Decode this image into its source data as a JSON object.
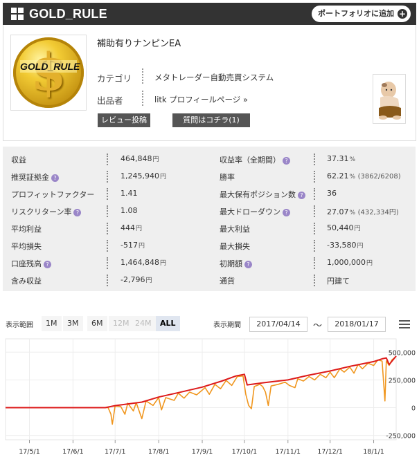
{
  "header": {
    "title": "GOLD_RULE",
    "portfolio_button": "ポートフォリオに追加",
    "plus_glyph": "+"
  },
  "product": {
    "logo_text": "GOLD_RULE",
    "logo_glyph": "$",
    "name": "補助有りナンピンEA",
    "category_label": "カテゴリ",
    "category_value": "メタトレーダー自動売買システム",
    "seller_label": "出品者",
    "seller_value": "litk プロフィールページ »",
    "review_button": "レビュー投稿",
    "question_button": "質問はコチラ(1)"
  },
  "stats": [
    {
      "l": "収益",
      "lq": false,
      "v": "464,848",
      "vu": "円",
      "l2": "収益率（全期間）",
      "l2q": true,
      "v2": "37.31",
      "v2u": "%",
      "v2s": ""
    },
    {
      "l": "推奨証拠金",
      "lq": true,
      "v": "1,245,940",
      "vu": "円",
      "l2": "勝率",
      "l2q": false,
      "v2": "62.21",
      "v2u": "%",
      "v2s": "(3862/6208)"
    },
    {
      "l": "プロフィットファクター",
      "lq": false,
      "v": "1.41",
      "vu": "",
      "l2": "最大保有ポジション数",
      "l2q": true,
      "v2": "36",
      "v2u": "",
      "v2s": ""
    },
    {
      "l": "リスクリターン率",
      "lq": true,
      "v": "1.08",
      "vu": "",
      "l2": "最大ドローダウン",
      "l2q": true,
      "v2": "27.07",
      "v2u": "%",
      "v2s": "(432,334円)"
    },
    {
      "l": "平均利益",
      "lq": false,
      "v": "444",
      "vu": "円",
      "l2": "最大利益",
      "l2q": false,
      "v2": "50,440",
      "v2u": "円",
      "v2s": ""
    },
    {
      "l": "平均損失",
      "lq": false,
      "v": "-517",
      "vu": "円",
      "l2": "最大損失",
      "l2q": false,
      "v2": "-33,580",
      "v2u": "円",
      "v2s": ""
    },
    {
      "l": "口座残高",
      "lq": true,
      "v": "1,464,848",
      "vu": "円",
      "l2": "初期額",
      "l2q": true,
      "v2": "1,000,000",
      "v2u": "円",
      "v2s": ""
    },
    {
      "l": "含み収益",
      "lq": false,
      "v": "-2,796",
      "vu": "円",
      "l2": "通貨",
      "l2q": false,
      "v2": "円建て",
      "v2u": "",
      "v2s": ""
    }
  ],
  "question_glyph": "?",
  "chart_controls": {
    "range_label": "表示範囲",
    "range_buttons": [
      {
        "label": "1M",
        "state": "normal"
      },
      {
        "label": "3M",
        "state": "normal"
      },
      {
        "label": "6M",
        "state": "normal"
      },
      {
        "label": "12M",
        "state": "disabled"
      },
      {
        "label": "24M",
        "state": "disabled"
      },
      {
        "label": "ALL",
        "state": "selected"
      }
    ],
    "period_label": "表示期間",
    "date_from": "2017/04/14",
    "tilde": "～",
    "date_to": "2018/01/17"
  },
  "chart_data": {
    "type": "line",
    "x_ticks": [
      "17/5/1",
      "17/6/1",
      "17/7/1",
      "17/8/1",
      "17/9/1",
      "17/10/1",
      "17/11/1",
      "17/12/1",
      "18/1/1"
    ],
    "y_ticks": [
      "500,000",
      "250,000",
      "0",
      "-250,000"
    ],
    "ylim": [
      -290000,
      620000
    ],
    "xlim": [
      "2017-04-14",
      "2018-01-17"
    ],
    "grid": true,
    "series": [
      {
        "color": "#dd1a1a",
        "points": [
          [
            "2017-04-14",
            0
          ],
          [
            "2017-06-24",
            0
          ],
          [
            "2017-07-01",
            18000
          ],
          [
            "2017-07-20",
            50000
          ],
          [
            "2017-08-01",
            95000
          ],
          [
            "2017-08-15",
            135000
          ],
          [
            "2017-09-01",
            185000
          ],
          [
            "2017-09-15",
            240000
          ],
          [
            "2017-09-25",
            285000
          ],
          [
            "2017-10-01",
            300000
          ],
          [
            "2017-10-03",
            205000
          ],
          [
            "2017-10-15",
            225000
          ],
          [
            "2017-11-01",
            250000
          ],
          [
            "2017-11-15",
            290000
          ],
          [
            "2017-12-01",
            330000
          ],
          [
            "2017-12-15",
            372000
          ],
          [
            "2018-01-01",
            415000
          ],
          [
            "2018-01-07",
            440000
          ],
          [
            "2018-01-10",
            448000
          ],
          [
            "2018-01-12",
            388000
          ],
          [
            "2018-01-17",
            465000
          ]
        ]
      },
      {
        "color": "#f0961e",
        "points": [
          [
            "2017-04-14",
            0
          ],
          [
            "2017-06-26",
            0
          ],
          [
            "2017-06-28",
            -60000
          ],
          [
            "2017-06-29",
            -150000
          ],
          [
            "2017-07-01",
            15000
          ],
          [
            "2017-07-05",
            10000
          ],
          [
            "2017-07-08",
            -60000
          ],
          [
            "2017-07-10",
            40000
          ],
          [
            "2017-07-14",
            -30000
          ],
          [
            "2017-07-16",
            45000
          ],
          [
            "2017-07-20",
            -100000
          ],
          [
            "2017-07-23",
            60000
          ],
          [
            "2017-07-28",
            20000
          ],
          [
            "2017-08-01",
            90000
          ],
          [
            "2017-08-03",
            -20000
          ],
          [
            "2017-08-06",
            90000
          ],
          [
            "2017-08-12",
            65000
          ],
          [
            "2017-08-15",
            130000
          ],
          [
            "2017-08-19",
            85000
          ],
          [
            "2017-08-23",
            140000
          ],
          [
            "2017-08-28",
            115000
          ],
          [
            "2017-09-03",
            180000
          ],
          [
            "2017-09-06",
            120000
          ],
          [
            "2017-09-10",
            210000
          ],
          [
            "2017-09-14",
            170000
          ],
          [
            "2017-09-18",
            245000
          ],
          [
            "2017-09-22",
            200000
          ],
          [
            "2017-09-26",
            280000
          ],
          [
            "2017-09-30",
            285000
          ],
          [
            "2017-10-02",
            120000
          ],
          [
            "2017-10-04",
            20000
          ],
          [
            "2017-10-06",
            -10000
          ],
          [
            "2017-10-08",
            190000
          ],
          [
            "2017-10-10",
            200000
          ],
          [
            "2017-10-12",
            210000
          ],
          [
            "2017-10-14",
            190000
          ],
          [
            "2017-10-16",
            140000
          ],
          [
            "2017-10-18",
            20000
          ],
          [
            "2017-10-20",
            195000
          ],
          [
            "2017-10-25",
            210000
          ],
          [
            "2017-10-30",
            230000
          ],
          [
            "2017-11-02",
            200000
          ],
          [
            "2017-11-06",
            180000
          ],
          [
            "2017-11-08",
            260000
          ],
          [
            "2017-11-12",
            240000
          ],
          [
            "2017-11-16",
            280000
          ],
          [
            "2017-11-20",
            250000
          ],
          [
            "2017-11-24",
            300000
          ],
          [
            "2017-11-28",
            270000
          ],
          [
            "2017-12-01",
            320000
          ],
          [
            "2017-12-04",
            270000
          ],
          [
            "2017-12-08",
            350000
          ],
          [
            "2017-12-11",
            320000
          ],
          [
            "2017-12-15",
            365000
          ],
          [
            "2017-12-18",
            310000
          ],
          [
            "2017-12-21",
            390000
          ],
          [
            "2017-12-24",
            350000
          ],
          [
            "2017-12-28",
            400000
          ],
          [
            "2018-01-01",
            380000
          ],
          [
            "2018-01-04",
            430000
          ],
          [
            "2018-01-07",
            420000
          ],
          [
            "2018-01-09",
            60000
          ],
          [
            "2018-01-10",
            420000
          ],
          [
            "2018-01-12",
            380000
          ],
          [
            "2018-01-14",
            430000
          ],
          [
            "2018-01-17",
            462000
          ]
        ]
      }
    ]
  }
}
